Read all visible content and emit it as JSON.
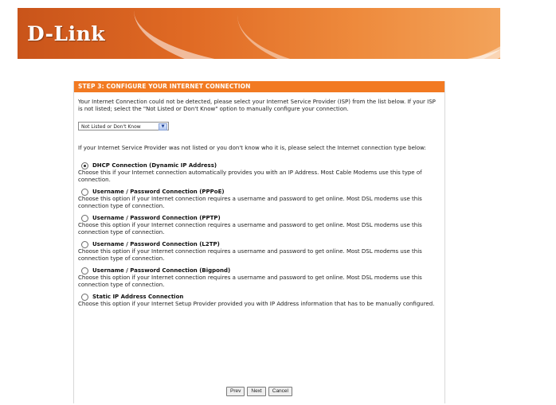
{
  "brand": {
    "logo_text": "D-Link"
  },
  "colors": {
    "banner_orange": "#e06a24",
    "title_bar": "#f27a22"
  },
  "panel": {
    "title": "STEP 3: CONFIGURE YOUR INTERNET CONNECTION",
    "intro": "Your Internet Connection could not be detected, please select your Internet Service Provider (ISP) from the list below. If your ISP is not listed; select the \"Not Listed or Don't Know\" option to manually configure your connection.",
    "isp_select": {
      "value": "Not Listed or Don't Know"
    },
    "help_text": "If your Internet Service Provider was not listed or you don't know who it is, please select the Internet connection type below:",
    "options": [
      {
        "label": "DHCP Connection (Dynamic IP Address)",
        "desc": "Choose this if your Internet connection automatically provides you with an IP Address. Most Cable Modems use this type of connection.",
        "checked": true
      },
      {
        "label": "Username / Password Connection (PPPoE)",
        "desc": "Choose this option if your Internet connection requires a username and password to get online. Most DSL modems use this connection type of connection.",
        "checked": false
      },
      {
        "label": "Username / Password Connection (PPTP)",
        "desc": "Choose this option if your Internet connection requires a username and password to get online. Most DSL modems use this connection type of connection.",
        "checked": false
      },
      {
        "label": "Username / Password Connection (L2TP)",
        "desc": "Choose this option if your Internet connection requires a username and password to get online. Most DSL modems use this connection type of connection.",
        "checked": false
      },
      {
        "label": "Username / Password Connection (Bigpond)",
        "desc": "Choose this option if your Internet connection requires a username and password to get online. Most DSL modems use this connection type of connection.",
        "checked": false
      },
      {
        "label": "Static IP Address Connection",
        "desc": "Choose this option if your Internet Setup Provider provided you with IP Address information that has to be manually configured.",
        "checked": false
      }
    ],
    "buttons": {
      "prev": "Prev",
      "next": "Next",
      "cancel": "Cancel"
    }
  }
}
